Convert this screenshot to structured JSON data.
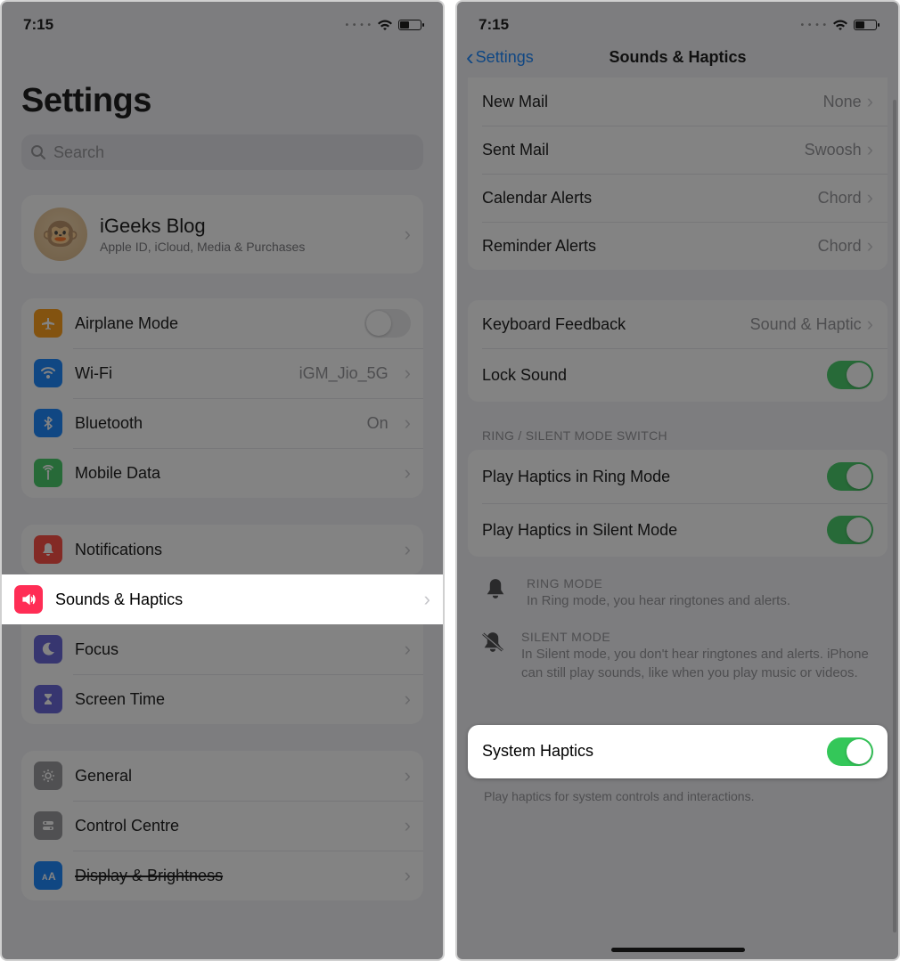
{
  "status": {
    "time": "7:15"
  },
  "left": {
    "title": "Settings",
    "search_placeholder": "Search",
    "profile": {
      "name": "iGeeks Blog",
      "sub": "Apple ID, iCloud, Media & Purchases"
    },
    "rows1": {
      "airplane": "Airplane Mode",
      "wifi": "Wi-Fi",
      "wifi_val": "iGM_Jio_5G",
      "bluetooth": "Bluetooth",
      "bluetooth_val": "On",
      "mobile": "Mobile Data"
    },
    "rows2": {
      "notif": "Notifications",
      "sounds": "Sounds & Haptics",
      "focus": "Focus",
      "screentime": "Screen Time"
    },
    "rows3": {
      "general": "General",
      "control": "Control Centre",
      "display": "Display & Brightness"
    }
  },
  "right": {
    "back": "Settings",
    "title": "Sounds & Haptics",
    "card1": {
      "newmail": "New Mail",
      "newmail_val": "None",
      "sentmail": "Sent Mail",
      "sentmail_val": "Swoosh",
      "cal": "Calendar Alerts",
      "cal_val": "Chord",
      "rem": "Reminder Alerts",
      "rem_val": "Chord"
    },
    "card2": {
      "kbd": "Keyboard Feedback",
      "kbd_val": "Sound & Haptic",
      "lock": "Lock Sound"
    },
    "section2_head": "RING / SILENT MODE SWITCH",
    "card3": {
      "ring": "Play Haptics in Ring Mode",
      "silent": "Play Haptics in Silent Mode"
    },
    "desc": {
      "ring_h": "RING MODE",
      "ring_b": "In Ring mode, you hear ringtones and alerts.",
      "silent_h": "SILENT MODE",
      "silent_b": "In Silent mode, you don't hear ringtones and alerts. iPhone can still play sounds, like when you play music or videos."
    },
    "card4": {
      "sys": "System Haptics"
    },
    "footer": "Play haptics for system controls and interactions."
  }
}
